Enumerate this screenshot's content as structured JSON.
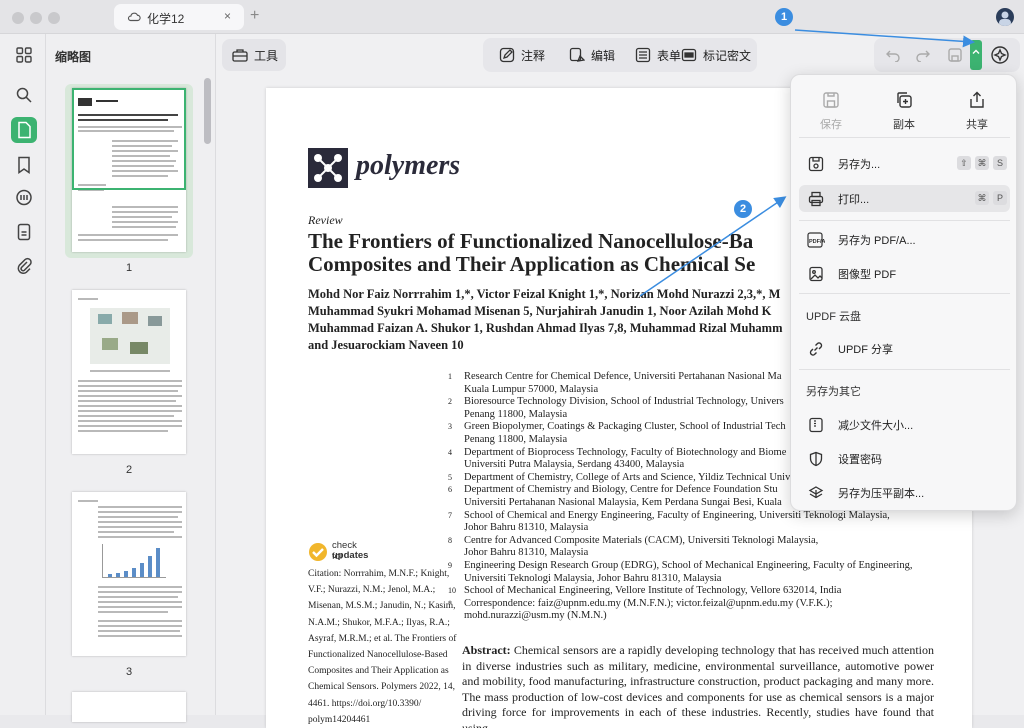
{
  "tab": {
    "title": "化学12",
    "close": "×",
    "new": "+"
  },
  "sidebar": {
    "header": "缩略图"
  },
  "thumbnails": [
    {
      "page": "1"
    },
    {
      "page": "2"
    },
    {
      "page": "3"
    }
  ],
  "toolbar": {
    "tools_label": "工具",
    "annotate_label": "注释",
    "edit_label": "编辑",
    "form_label": "表单",
    "redact_label": "标记密文"
  },
  "document": {
    "journal": "polymers",
    "type": "Review",
    "title_line1": "The Frontiers of Functionalized Nanocellulose-Ba",
    "title_line2": "Composites and Their Application as Chemical Se",
    "authors": [
      "Mohd Nor Faiz Norrrahim 1,*, Victor Feizal Knight 1,*, Norizan Mohd Nurazzi 2,3,*, M",
      "Muhammad Syukri Mohamad Misenan 5, Nurjahirah Janudin 1, Noor Azilah Mohd K",
      "Muhammad Faizan A. Shukor 1, Rushdan Ahmad Ilyas 7,8, Muhammad Rizal Muhamm",
      "and Jesuarockiam Naveen 10"
    ],
    "affiliations": [
      {
        "n": "1",
        "lines": [
          "Research Centre for Chemical Defence, Universiti Pertahanan Nasional Ma",
          "Kuala Lumpur 57000, Malaysia"
        ]
      },
      {
        "n": "2",
        "lines": [
          "Bioresource Technology Division, School of Industrial Technology, Univers",
          "Penang 11800, Malaysia"
        ]
      },
      {
        "n": "3",
        "lines": [
          "Green Biopolymer, Coatings & Packaging Cluster, School of Industrial Tech",
          "Penang 11800, Malaysia"
        ]
      },
      {
        "n": "4",
        "lines": [
          "Department of Bioprocess Technology, Faculty of Biotechnology and Biome",
          "Universiti Putra Malaysia, Serdang 43400, Malaysia"
        ]
      },
      {
        "n": "5",
        "lines": [
          "Department of Chemistry, College of Arts and Science, Yildiz Technical Univer"
        ]
      },
      {
        "n": "6",
        "lines": [
          "Department of Chemistry and Biology, Centre for Defence Foundation Stu",
          "Universiti Pertahanan Nasional Malaysia, Kem Perdana Sungai Besi, Kuala"
        ]
      },
      {
        "n": "7",
        "lines": [
          "School of Chemical and Energy Engineering, Faculty of Engineering, Universiti Teknologi Malaysia,",
          "Johor Bahru 81310, Malaysia"
        ]
      },
      {
        "n": "8",
        "lines": [
          "Centre for Advanced Composite Materials (CACM), Universiti Teknologi Malaysia,",
          "Johor Bahru 81310, Malaysia"
        ]
      },
      {
        "n": "9",
        "lines": [
          "Engineering Design Research Group (EDRG), School of Mechanical Engineering, Faculty of Engineering,",
          "Universiti Teknologi Malaysia, Johor Bahru 81310, Malaysia"
        ]
      },
      {
        "n": "10",
        "lines": [
          "School of Mechanical Engineering, Vellore Institute of Technology, Vellore 632014, India"
        ]
      },
      {
        "n": "*",
        "lines": [
          "Correspondence: faiz@upnm.edu.my (M.N.F.N.); victor.feizal@upnm.edu.my (V.F.K.);",
          "mohd.nurazzi@usm.my (N.M.N.)"
        ]
      }
    ],
    "check_for": "check for",
    "updates": "updates",
    "citation_lines": [
      "Citation: Norrrahim, M.N.F.; Knight,",
      "V.F.; Nurazzi, N.M.; Jenol, M.A.;",
      "Misenan, M.S.M.; Janudin, N.; Kasim,",
      "N.A.M.; Shukor, M.F.A.; Ilyas, R.A.;",
      "Asyraf, M.R.M.; et al. The Frontiers of",
      "Functionalized Nanocellulose-Based",
      "Composites and Their Application as",
      "Chemical Sensors. Polymers 2022, 14,",
      "4461.  https://doi.org/10.3390/",
      "polym14204461"
    ],
    "abstract_label": "Abstract:",
    "abstract_text": "Chemical sensors are a rapidly developing technology that has received much attention in diverse industries such as military, medicine, environmental surveillance, automotive power and mobility, food manufacturing, infrastructure construction, product packaging and many more. The mass production of low-cost devices and components for use as chemical sensors is a major driving force for improvements in each of these industries. Recently, studies have found that using"
  },
  "menu": {
    "quick": [
      {
        "label": "保存",
        "icon": "save-icon",
        "disabled": true
      },
      {
        "label": "副本",
        "icon": "duplicate-icon",
        "disabled": false
      },
      {
        "label": "共享",
        "icon": "share-icon",
        "disabled": false
      }
    ],
    "save_as": "另存为...",
    "save_as_keys": [
      "⇧",
      "⌘",
      "S"
    ],
    "print": "打印...",
    "print_keys": [
      "⌘",
      "P"
    ],
    "save_pdfa": "另存为 PDF/A...",
    "image_pdf": "图像型 PDF",
    "cloud_section": "UPDF 云盘",
    "updf_share": "UPDF 分享",
    "other_section": "另存为其它",
    "reduce_size": "减少文件大小...",
    "set_password": "设置密码",
    "save_flatten": "另存为压平副本..."
  },
  "annotations": {
    "badge1": "1",
    "badge2": "2"
  },
  "colors": {
    "accent": "#3cb371",
    "badge": "#3b8de0"
  }
}
